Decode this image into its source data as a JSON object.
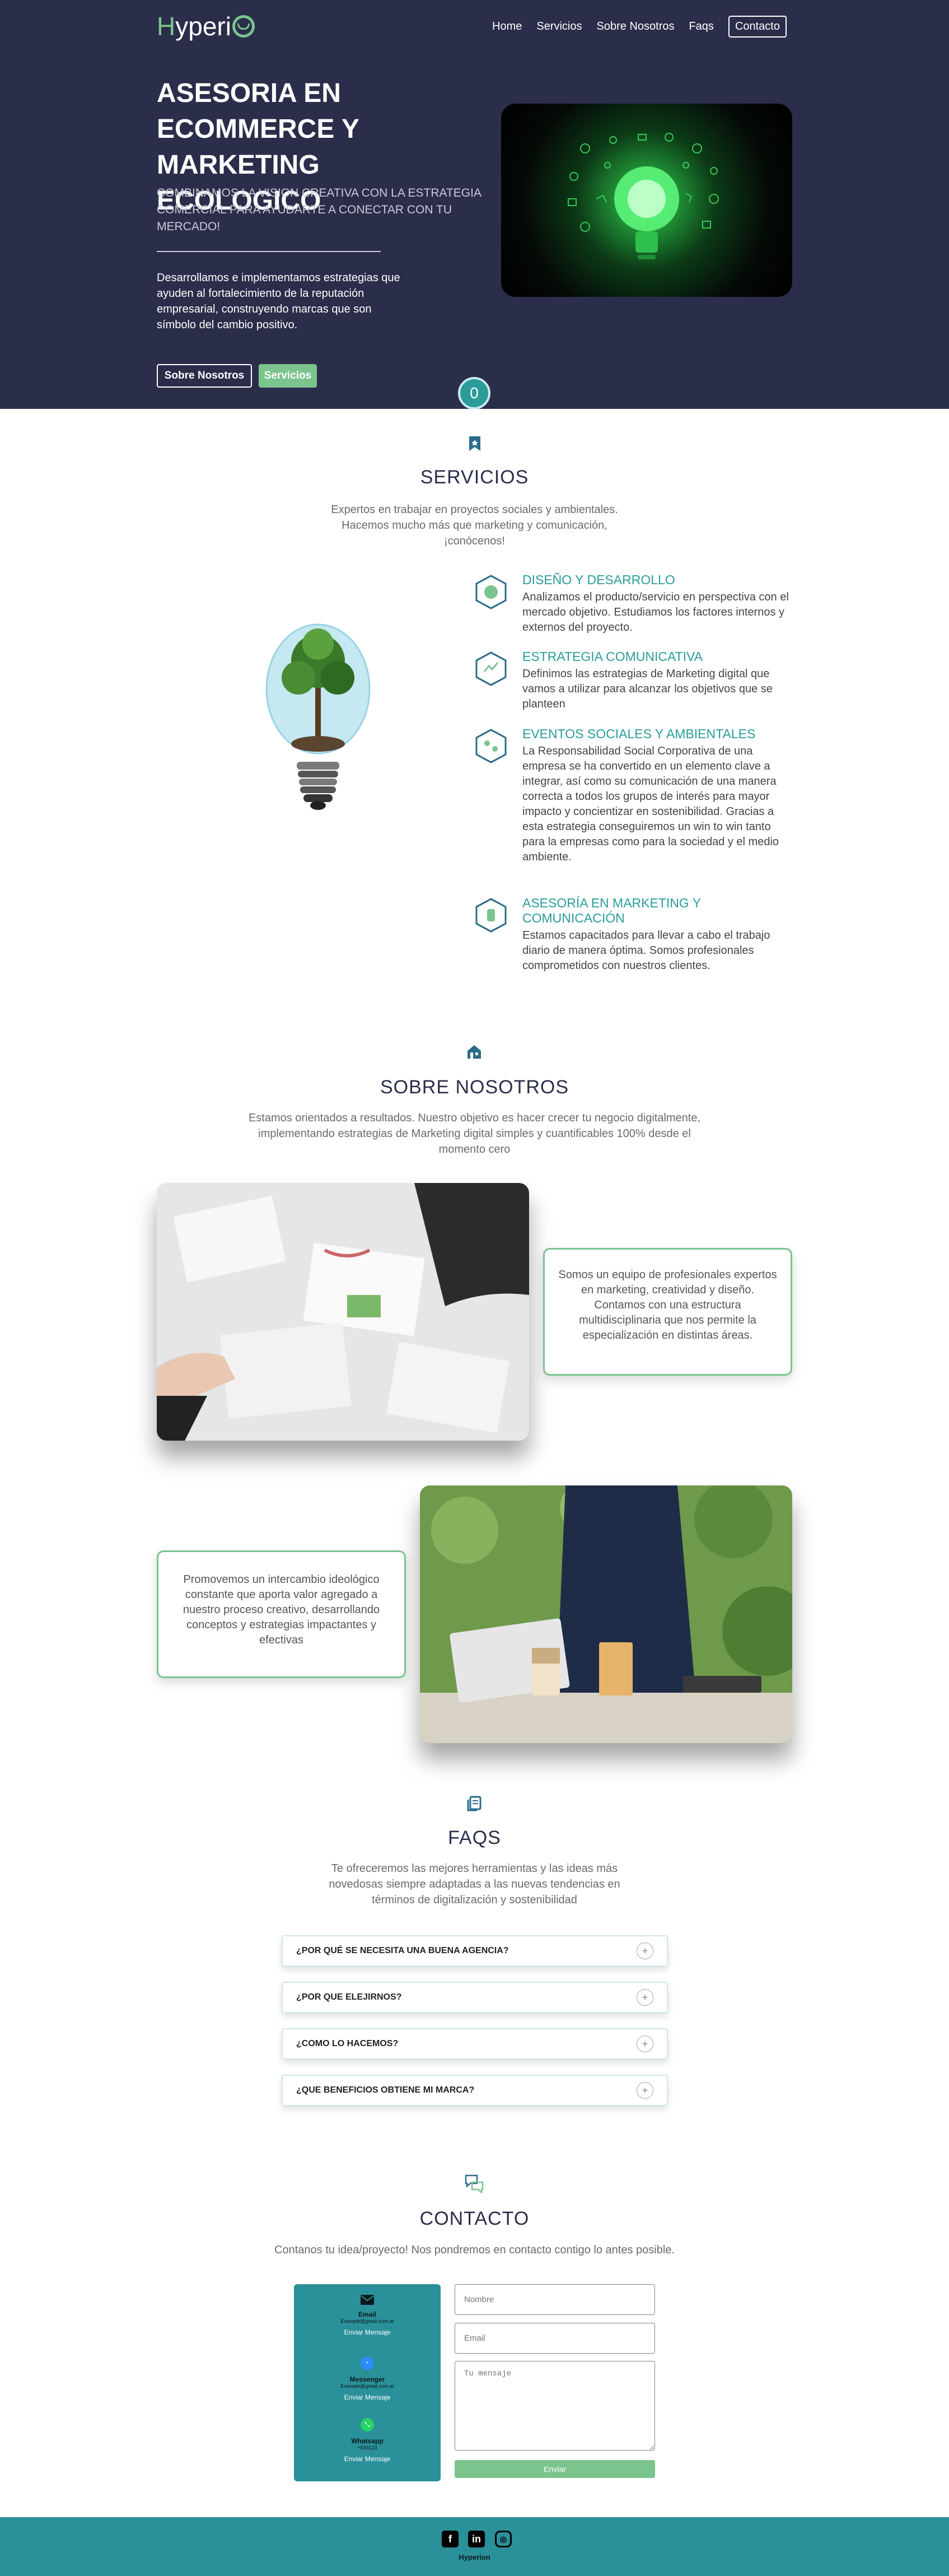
{
  "nav": {
    "logo": "Hyperion",
    "links": [
      "Home",
      "Servicios",
      "Sobre Nosotros",
      "Faqs",
      "Contacto"
    ]
  },
  "hero": {
    "title": "ASESORIA EN ECOMMERCE Y MARKETING ECOLOGICO",
    "subtitle": "COMBINAMOS LA VISION CREATIVA CON LA ESTRATEGIA COMERCIAL PARA AYUDARTE A CONECTAR CON TU MERCADO!",
    "description": "Desarrollamos e implementamos estrategias que ayuden al fortalecimiento de la reputación empresarial, construyendo marcas que son símbolo del cambio positivo.",
    "btn_about": "Sobre Nosotros",
    "btn_services": "Servicios",
    "badge": "0"
  },
  "services": {
    "title": "SERVICIOS",
    "lead": "Expertos en trabajar en proyectos sociales y ambientales. Hacemos mucho más que marketing y comunicación, ¡conócenos!",
    "items": [
      {
        "title": "DISEÑO Y DESARROLLO",
        "text": "Analizamos el producto/servicio en perspectiva con el mercado objetivo. Estudiamos los factores internos y externos del proyecto."
      },
      {
        "title": "ESTRATEGIA COMUNICATIVA",
        "text": "Definimos las estrategias de Marketing digital que vamos a utilizar para alcanzar los objetivos que se planteen"
      },
      {
        "title": "EVENTOS SOCIALES Y AMBIENTALES",
        "text": "La Responsabilidad Social Corporativa de una empresa se ha convertido en un elemento clave a integrar, así como su comunicación de una manera correcta a todos los grupos de interés para mayor impacto y concientizar en sostenibilidad. Gracias a esta estrategia conseguiremos un win to win tanto para la empresas como para la sociedad y el medio ambiente."
      },
      {
        "title": "ASESORÍA EN MARKETING Y COMUNICACIÓN",
        "text": "Estamos capacitados para llevar a cabo el trabajo diario de manera óptima. Somos profesionales comprometidos con nuestros clientes."
      }
    ]
  },
  "about": {
    "title": "SOBRE NOSOTROS",
    "lead": "Estamos orientados a resultados. Nuestro objetivo es hacer crecer tu negocio digitalmente, implementando estrategias de Marketing digital simples y cuantificables 100% desde el momento cero",
    "card1": "Somos un equipo de profesionales expertos en marketing, creatividad y diseño. Contamos con una estructura multidisciplinaria que nos permite la especialización en distintas áreas.",
    "card2": "Promovemos un intercambio ideológico constante que aporta valor agregado a nuestro proceso creativo, desarrollando conceptos y estrategias impactantes y efectivas"
  },
  "faqs": {
    "title": "FAQS",
    "lead": "Te ofreceremos las mejores herramientas y las ideas más novedosas siempre adaptadas a las nuevas tendencias en términos de digitalización y sostenibilidad",
    "items": [
      "¿POR QUÉ SE NECESITA UNA BUENA AGENCIA?",
      "¿POR QUE ELEJIRNOS?",
      "¿COMO LO HACEMOS?",
      "¿QUE BENEFICIOS OBTIENE MI MARCA?"
    ]
  },
  "contact": {
    "title": "CONTACTO",
    "lead": "Contanos tu idea/proyecto! Nos pondremos en contacto contigo lo antes posible.",
    "channels": [
      {
        "name": "Email",
        "value": "Example@gmail.com.ar",
        "action": "Enviar Mensaje"
      },
      {
        "name": "Messenger",
        "value": "Example@gmail.com.ar",
        "action": "Enviar Mensaje"
      },
      {
        "name": "Whatsapp",
        "value": "+549123",
        "action": "Enviar Mensaje"
      }
    ],
    "name_placeholder": "Nombre",
    "email_placeholder": "Email",
    "message_placeholder": "Tu mensaje",
    "send": "Enviar"
  },
  "footer": {
    "brand": "Hyperion"
  },
  "colors": {
    "navy": "#2b2e4a",
    "teal": "#2a9d9a",
    "green": "#7bc48e"
  }
}
